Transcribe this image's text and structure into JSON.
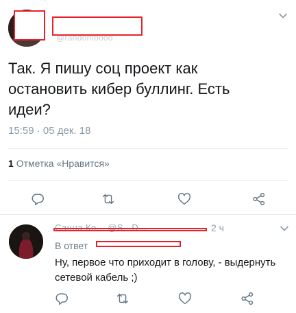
{
  "main_tweet": {
    "handle_ghost": "@randombooo",
    "text": "Так. Я пишу соц проект как остановить кибер буллинг. Есть идеи?",
    "time": "15:59",
    "separator": "·",
    "date": "05 дек. 18",
    "likes_count": "1",
    "likes_label": "Отметка «Нравится»"
  },
  "reply": {
    "name_ghost": "Санна Ко... @S...D...",
    "time": "2 ч",
    "reply_to_prefix": "В ответ",
    "text": "Ну, первое что приходит в голову, - выдернуть сетевой кабель ;)"
  },
  "icons": {
    "reply": "reply-icon",
    "retweet": "retweet-icon",
    "like": "heart-icon",
    "share": "share-icon",
    "menu": "chevron-down-icon"
  },
  "colors": {
    "redaction": "#e8222a",
    "icon": "#657786",
    "secondary_text": "#8899a6",
    "divider": "#e6ecf0"
  }
}
